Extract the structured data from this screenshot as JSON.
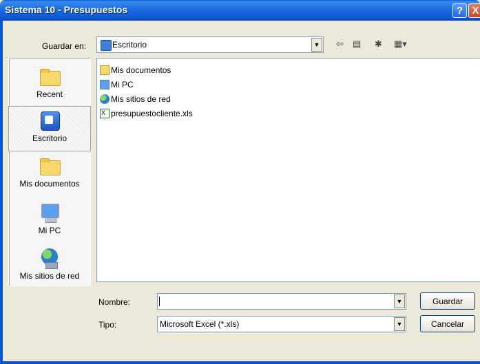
{
  "window": {
    "title": "Sistema 10 - Presupuestos",
    "help_button": "?",
    "close_button": "X"
  },
  "lookin": {
    "label": "Guardar en:",
    "value": "Escritorio"
  },
  "toolbar": {
    "icons": [
      "back-arrow-icon",
      "up-folder-icon",
      "new-folder-icon",
      "view-menu-icon"
    ]
  },
  "places": [
    {
      "label": "Recent",
      "icon": "recent-folder-icon"
    },
    {
      "label": "Escritorio",
      "icon": "desktop-icon",
      "selected": true
    },
    {
      "label": "Mis documentos",
      "icon": "my-documents-icon"
    },
    {
      "label": "Mi PC",
      "icon": "my-computer-icon"
    },
    {
      "label": "Mis sitios de red",
      "icon": "network-places-icon"
    }
  ],
  "files": [
    {
      "name": "Mis documentos",
      "icon": "my-documents-icon"
    },
    {
      "name": "Mi PC",
      "icon": "my-computer-icon"
    },
    {
      "name": "Mis sitios de red",
      "icon": "network-places-icon"
    },
    {
      "name": "presupuestocliente.xls",
      "icon": "excel-file-icon"
    }
  ],
  "filename": {
    "label": "Nombre:",
    "value": ""
  },
  "filetype": {
    "label": "Tipo:",
    "value": "Microsoft Excel (*.xls)"
  },
  "buttons": {
    "save": "Guardar",
    "cancel": "Cancelar"
  }
}
